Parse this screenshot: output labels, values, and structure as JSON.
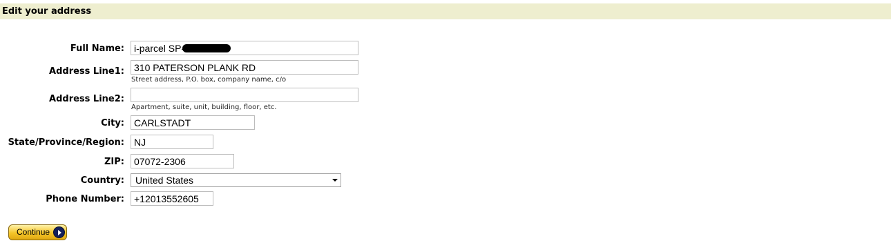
{
  "header": {
    "title": "Edit your address"
  },
  "form": {
    "full_name": {
      "label": "Full Name:",
      "value": "i-parcel SP-"
    },
    "address1": {
      "label": "Address Line1:",
      "value": "310 PATERSON PLANK RD",
      "hint": "Street address, P.O. box, company name, c/o"
    },
    "address2": {
      "label": "Address Line2:",
      "value": "",
      "hint": "Apartment, suite, unit, building, floor, etc."
    },
    "city": {
      "label": "City:",
      "value": "CARLSTADT"
    },
    "state": {
      "label": "State/Province/Region:",
      "value": "NJ"
    },
    "zip": {
      "label": "ZIP:",
      "value": "07072-2306"
    },
    "country": {
      "label": "Country:",
      "value": "United States"
    },
    "phone": {
      "label": "Phone Number:",
      "value": "+12013552605"
    }
  },
  "actions": {
    "continue_label": "Continue",
    "continue_icon": "arrow-right-circle-icon"
  }
}
